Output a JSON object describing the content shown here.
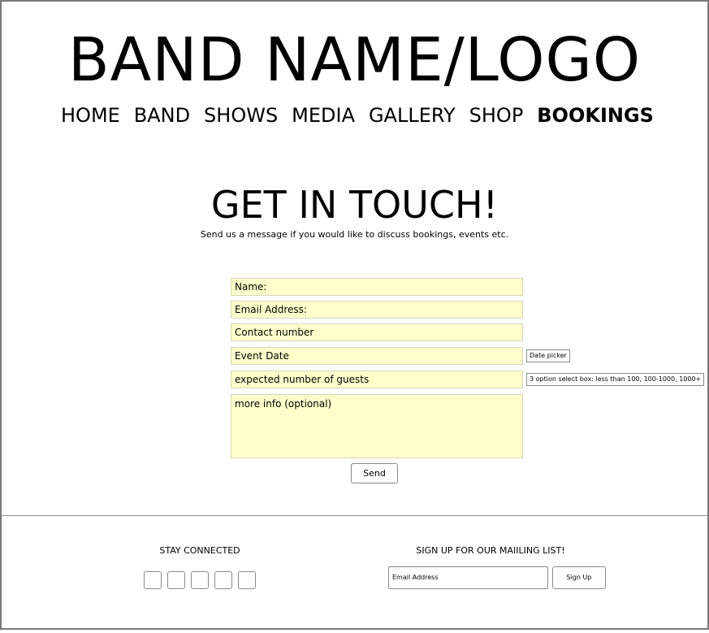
{
  "header": {
    "logo": "BAND NAME/LOGO",
    "nav": [
      {
        "label": "HOME",
        "active": false
      },
      {
        "label": "BAND",
        "active": false
      },
      {
        "label": "SHOWS",
        "active": false
      },
      {
        "label": "MEDIA",
        "active": false
      },
      {
        "label": "GALLERY",
        "active": false
      },
      {
        "label": "SHOP",
        "active": false
      },
      {
        "label": "BOOKINGS",
        "active": true
      }
    ]
  },
  "main": {
    "title": "GET IN TOUCH!",
    "subtitle": "Send us a message if you would like to discuss bookings, events etc.",
    "form": {
      "name": " Name:",
      "email": "Email Address:",
      "contact": "Contact number",
      "event_date": "Event Date",
      "event_date_note": "Date picker",
      "guests": "expected number of guests",
      "guests_note": "3 option select box: less than 100, 100-1000, 1000+",
      "more_info": "more info (optional)",
      "send_label": "Send"
    },
    "field_color": "#ffffcc"
  },
  "footer": {
    "stay_connected": "STAY CONNECTED",
    "social_icon_count": 5,
    "mailing_heading": "SIGN UP FOR OUR MAIILING LIST!",
    "email_placeholder": "Email Address",
    "signup_label": "Sign Up"
  }
}
